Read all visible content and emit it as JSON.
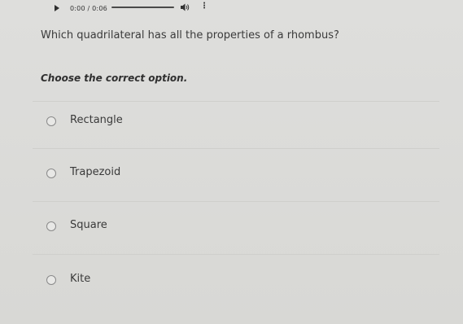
{
  "player": {
    "time": "0:00 / 0:06"
  },
  "question": {
    "text": "Which quadrilateral has all the properties of a rhombus?",
    "instruction": "Choose the correct option."
  },
  "options": [
    {
      "label": "Rectangle"
    },
    {
      "label": "Trapezoid"
    },
    {
      "label": "Square"
    },
    {
      "label": "Kite"
    }
  ],
  "icons": {
    "play": "play-icon",
    "volume": "volume-icon",
    "menu": "more-vertical-icon",
    "radio": "radio-unchecked-icon"
  }
}
